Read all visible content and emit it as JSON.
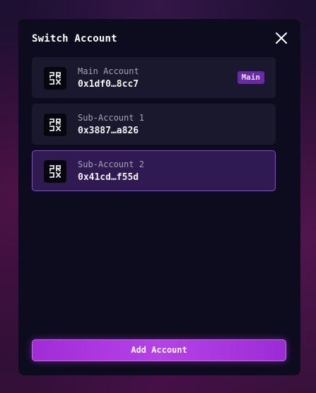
{
  "modal": {
    "title": "Switch Account",
    "close_icon": "close-icon",
    "add_button_label": "Add Account"
  },
  "accounts": [
    {
      "name": "Main Account",
      "address": "0x1df0…8cc7",
      "badge": "Main",
      "selected": false,
      "logo_icon": "prdx-logo-icon"
    },
    {
      "name": "Sub-Account 1",
      "address": "0x3887…a826",
      "selected": false,
      "logo_icon": "prdx-logo-icon"
    },
    {
      "name": "Sub-Account 2",
      "address": "0x41cd…f55d",
      "selected": true,
      "logo_icon": "prdx-logo-icon"
    }
  ],
  "colors": {
    "modal_bg": "#0d0c1e",
    "row_bg": "#19182c",
    "selected_row_bg": "#301a52",
    "selected_border": "#8b45e0",
    "badge_bg": "#6a2aa8",
    "accent": "#b542e8"
  }
}
